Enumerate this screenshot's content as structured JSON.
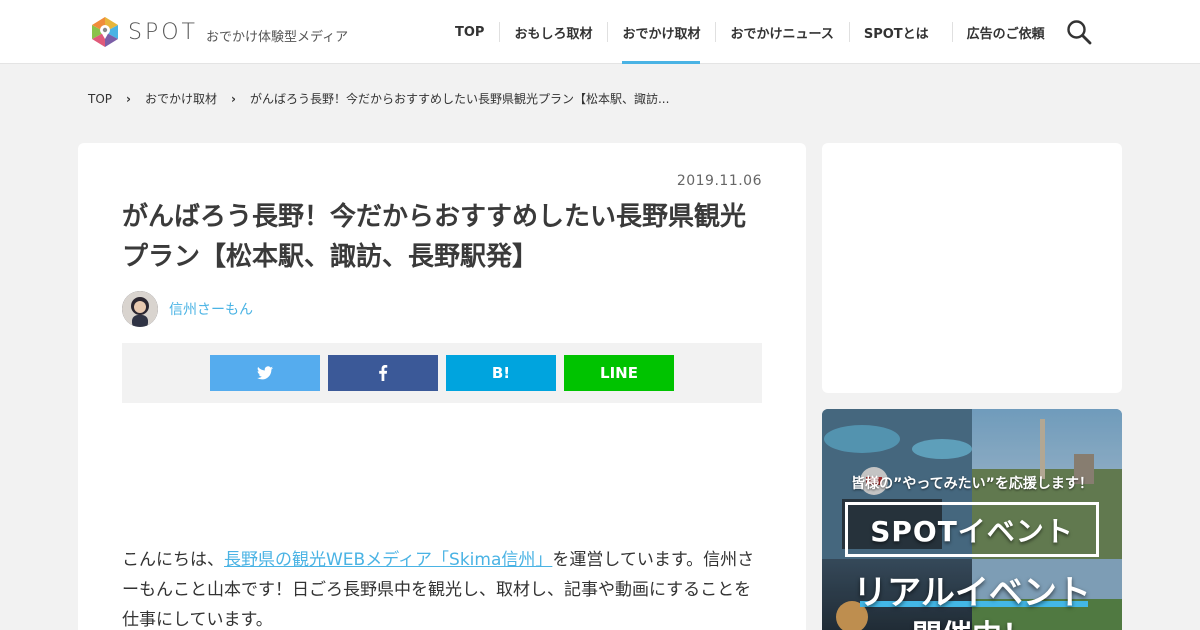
{
  "header": {
    "logo_name": "SPOT",
    "logo_tagline": "おでかけ体験型メディア",
    "nav": [
      {
        "label": "TOP",
        "active": false
      },
      {
        "label": "おもしろ取材",
        "active": false
      },
      {
        "label": "おでかけ取材",
        "active": true
      },
      {
        "label": "おでかけニュース",
        "active": false
      },
      {
        "label": "SPOTとは",
        "active": false
      },
      {
        "label": "広告のご依頼",
        "active": false
      }
    ],
    "search_icon": "search-icon",
    "accent_color": "#4ab3e4"
  },
  "breadcrumb": {
    "items": [
      "TOP",
      "おでかけ取材",
      "がんばろう長野！今だからおすすめしたい長野県観光プラン【松本駅、諏訪..."
    ],
    "separator_icon": "chevron-right-icon"
  },
  "article": {
    "date": "2019.11.06",
    "title": "がんばろう長野！今だからおすすめしたい長野県観光プラン【松本駅、諏訪、長野駅発】",
    "author_name": "信州さーもん",
    "share": {
      "twitter_icon": "twitter-icon",
      "facebook_icon": "facebook-icon",
      "hatena_label": "B!",
      "line_label": "LINE",
      "colors": {
        "twitter": "#55acee",
        "facebook": "#3b5998",
        "hatena": "#00a4de",
        "line": "#00c300"
      }
    },
    "body": {
      "prefix": "こんにちは、",
      "link_text": "長野県の観光WEBメディア「Skima信州」",
      "suffix": "を運営しています。信州さーもんこと山本です！日ごろ長野県中を観光し、取材し、記事や動画にすることを仕事にしています。"
    }
  },
  "sidebar": {
    "banner": {
      "text1": "皆様の”やってみたい”を応援します！",
      "text2": "SPOTイベント",
      "text3": "リアルイベント",
      "text4": "開催中！"
    }
  }
}
